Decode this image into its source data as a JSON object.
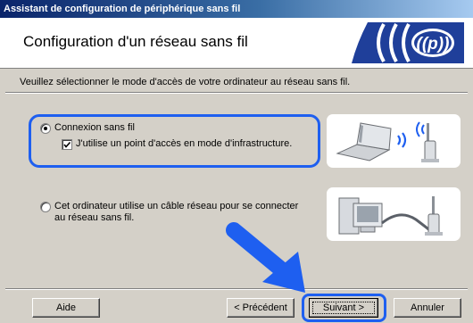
{
  "window": {
    "title": "Assistant de configuration de périphérique sans fil"
  },
  "header": {
    "title": "Configuration d'un réseau sans fil",
    "logo_icon": "wireless-signal-icon"
  },
  "instruction": "Veuillez sélectionner le mode d'accès de votre ordinateur au réseau sans fil.",
  "options": {
    "wireless": {
      "label": "Connexion sans fil",
      "selected": true
    },
    "infrastructure": {
      "label": "J'utilise un point d'accès en mode d'infrastructure.",
      "checked": true
    },
    "wired": {
      "label_line1": "Cet ordinateur utilise un câble réseau pour se connecter",
      "label_line2": "au réseau sans fil.",
      "selected": false
    }
  },
  "buttons": {
    "help": "Aide",
    "back": "< Précédent",
    "next": "Suivant >",
    "cancel": "Annuler"
  },
  "colors": {
    "highlight": "#1e5ff0",
    "arrow": "#1e5ff0",
    "titlebar": "#0a246a",
    "face": "#d4d0c8"
  }
}
